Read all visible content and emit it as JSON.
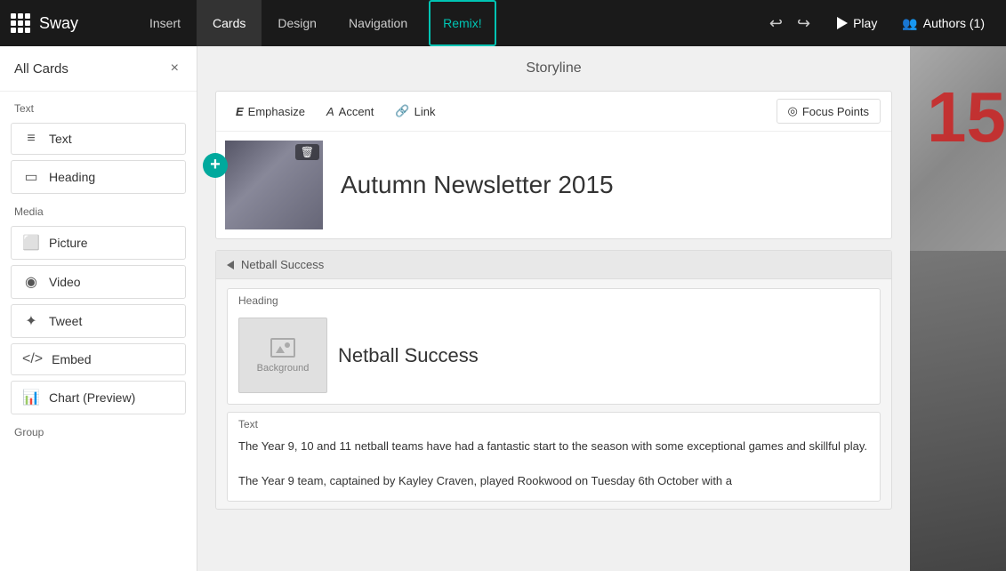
{
  "app": {
    "logo": "Sway",
    "nav": {
      "insert": "Insert",
      "cards": "Cards",
      "design": "Design",
      "navigation": "Navigation",
      "remix": "Remix!"
    },
    "play": "Play",
    "authors": "Authors (1)"
  },
  "sidebar": {
    "title": "All Cards",
    "close": "×",
    "sections": [
      {
        "label": "Text",
        "items": [
          {
            "icon": "≡",
            "label": "Text"
          },
          {
            "icon": "▭",
            "label": "Heading"
          }
        ]
      },
      {
        "label": "Media",
        "items": [
          {
            "icon": "🖼",
            "label": "Picture"
          },
          {
            "icon": "▶",
            "label": "Video"
          },
          {
            "icon": "🐦",
            "label": "Tweet"
          },
          {
            "icon": "</>",
            "label": "Embed"
          },
          {
            "icon": "📊",
            "label": "Chart (Preview)"
          }
        ]
      },
      {
        "label": "Group",
        "items": []
      }
    ]
  },
  "storyline": {
    "title": "Storyline"
  },
  "main_card": {
    "toolbar": {
      "emphasize": "Emphasize",
      "accent": "Accent",
      "link": "Link",
      "focus_points": "Focus Points"
    },
    "heading": "Autumn Newsletter 2015",
    "delete_label": "🗑"
  },
  "netball_card": {
    "section_title": "Netball Success",
    "inner_heading_label": "Heading",
    "bg_label": "Background",
    "inner_heading_text": "Netball Success",
    "text_label": "Text",
    "text_body_1": "The Year 9, 10 and 11 netball teams have had a fantastic start to the season with some exceptional games and skillful play.",
    "text_body_2": "The Year 9 team, captained by Kayley Craven, played Rookwood on Tuesday 6th October with a"
  },
  "right_panel": {
    "number": "15",
    "chevron": "‹"
  }
}
